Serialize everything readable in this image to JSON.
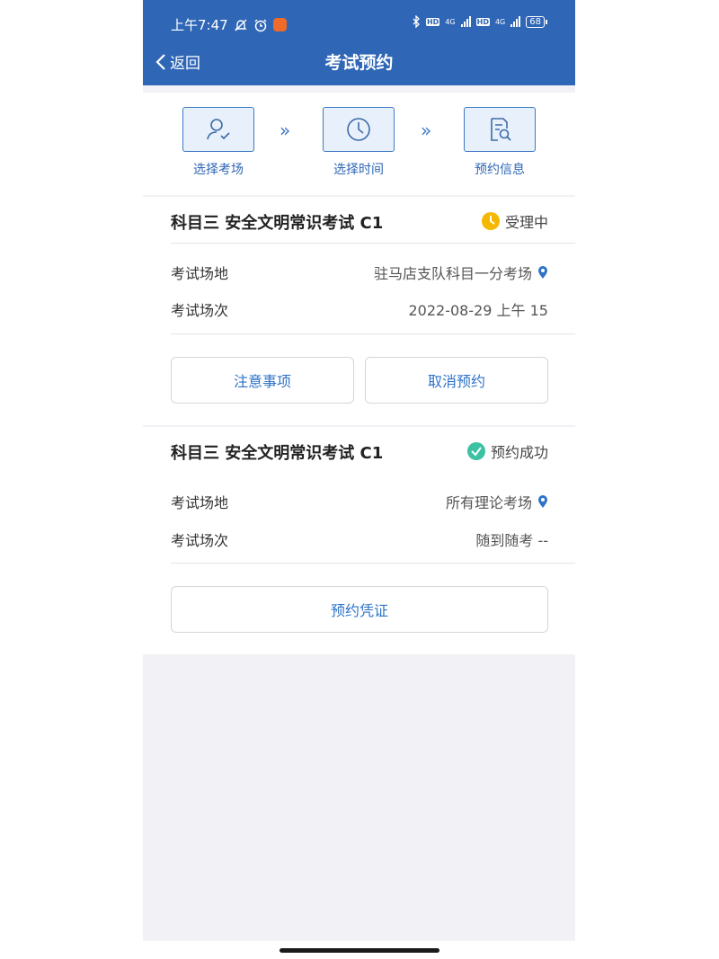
{
  "status_bar": {
    "time": "上午7:47",
    "battery": "68",
    "net1": "4G",
    "net2": "4G",
    "hd": "HD"
  },
  "header": {
    "back_label": "返回",
    "title": "考试预约"
  },
  "steps": [
    {
      "label": "选择考场",
      "icon": "person-check-icon"
    },
    {
      "label": "选择时间",
      "icon": "clock-icon"
    },
    {
      "label": "预约信息",
      "icon": "document-search-icon"
    }
  ],
  "step_arrow": "»",
  "cards": [
    {
      "title": "科目三 安全文明常识考试 C1",
      "status": "受理中",
      "status_color": "#f5b800",
      "venue_label": "考试场地",
      "venue_value": "驻马店支队科目一分考场",
      "session_label": "考试场次",
      "session_value": "2022-08-29 上午 15",
      "buttons": [
        "注意事项",
        "取消预约"
      ]
    },
    {
      "title": "科目三 安全文明常识考试 C1",
      "status": "预约成功",
      "status_color": "#3cc2a2",
      "venue_label": "考试场地",
      "venue_value": "所有理论考场",
      "session_label": "考试场次",
      "session_value": "随到随考 --",
      "buttons": [
        "预约凭证"
      ]
    }
  ],
  "colors": {
    "header_bg": "#2f66b6",
    "accent": "#2e73c8",
    "page_bg": "#f2f2f6"
  }
}
